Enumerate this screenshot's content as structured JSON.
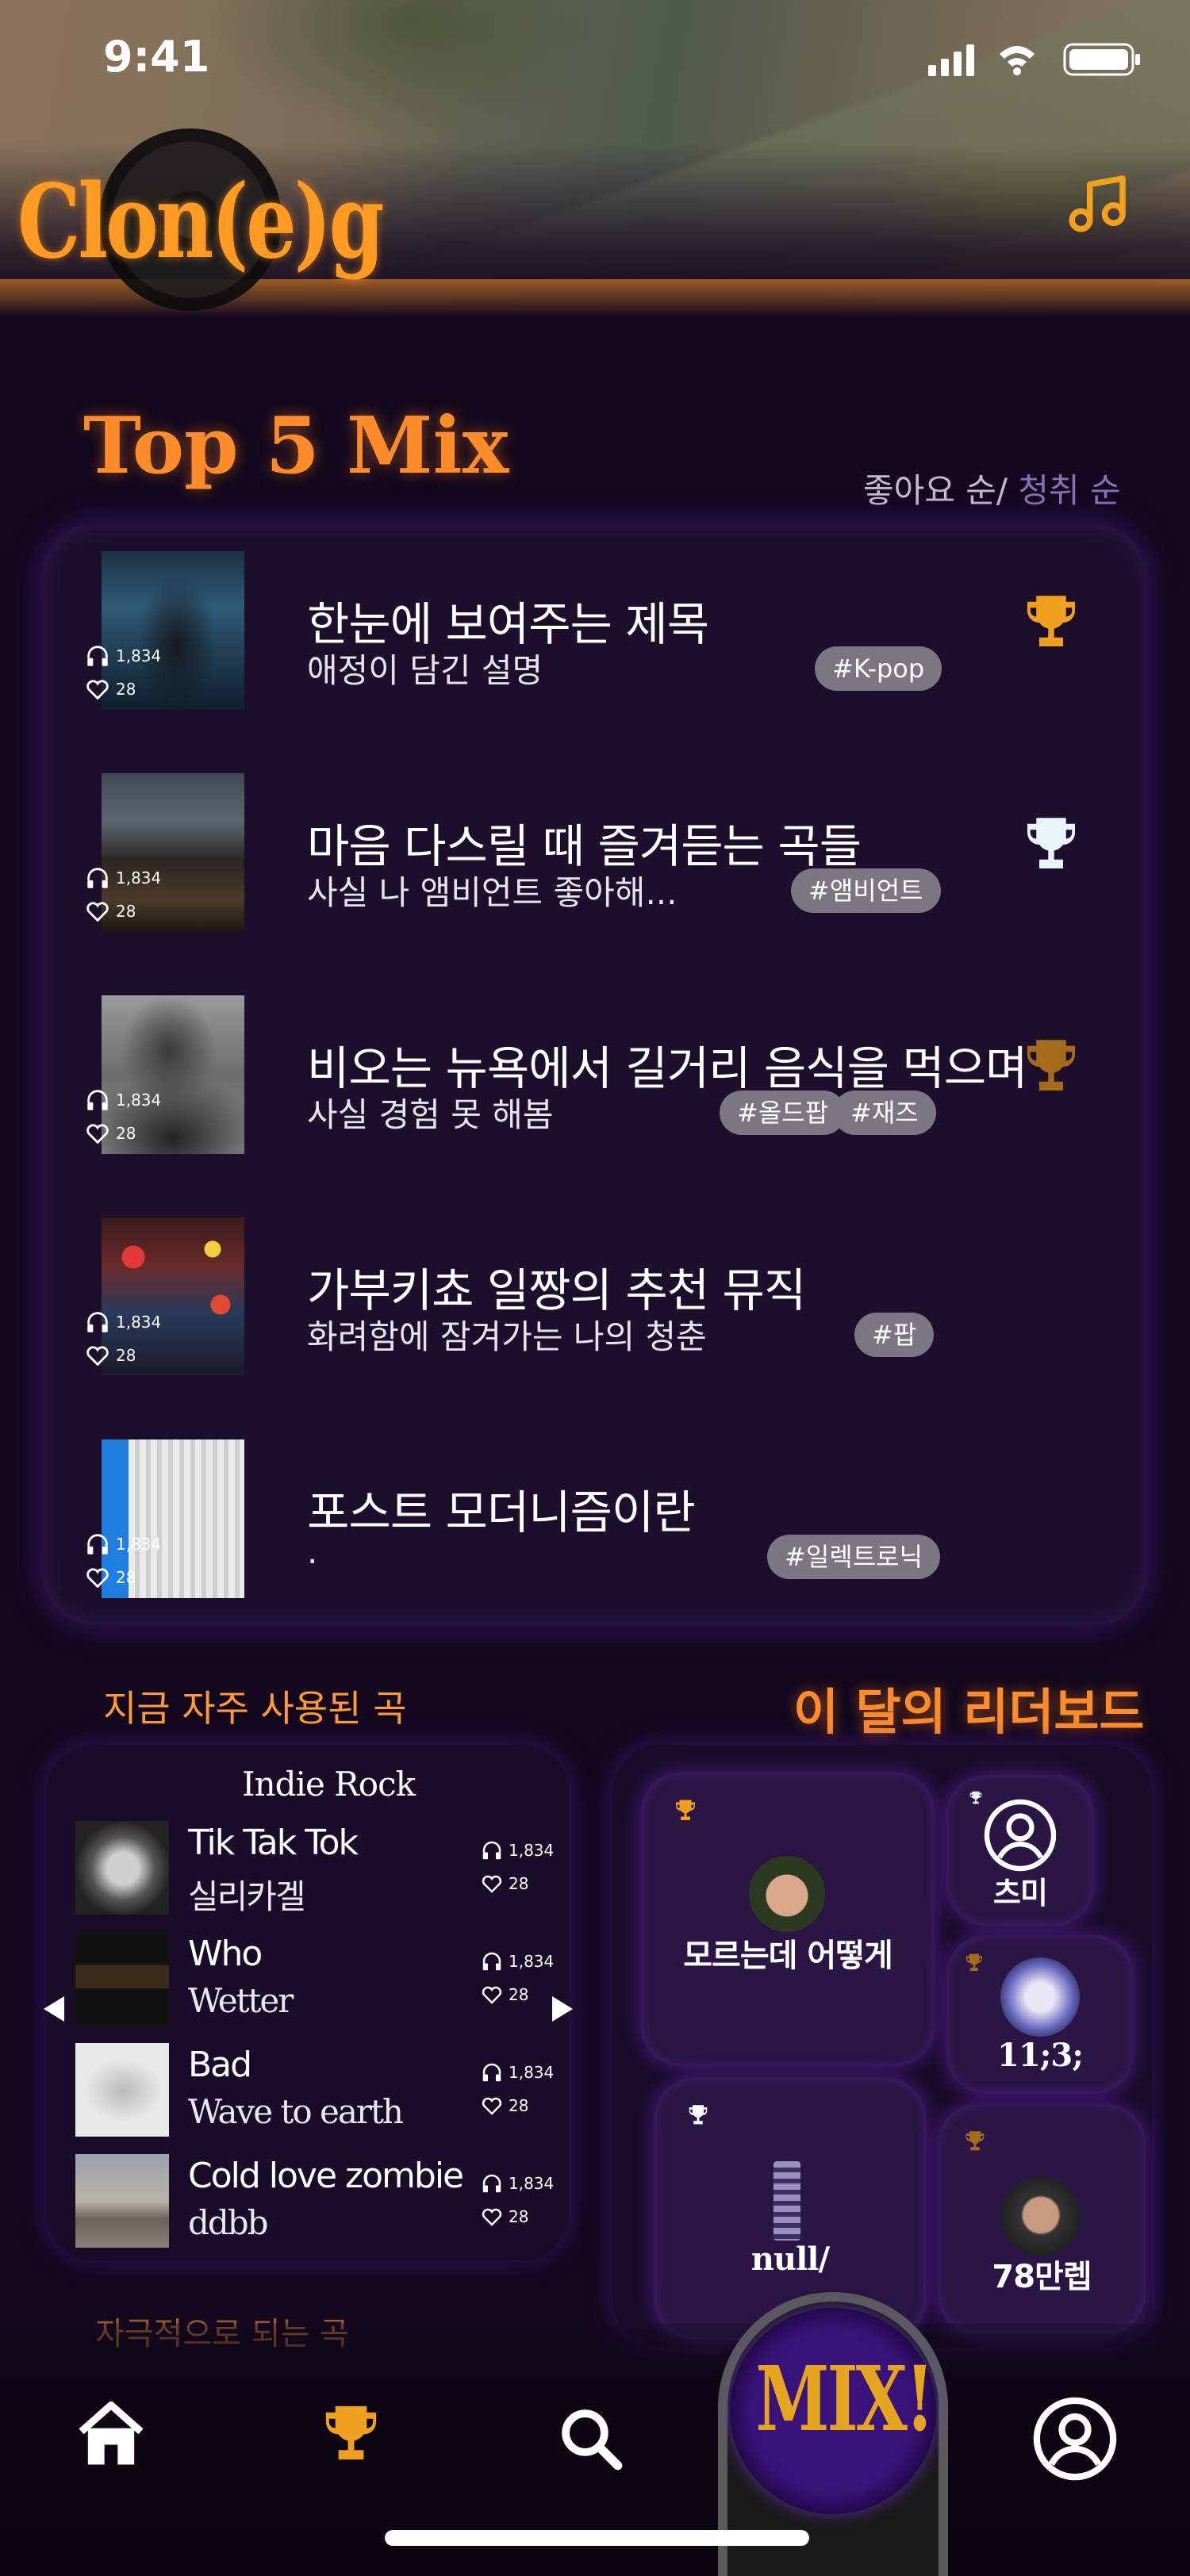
{
  "status_bar": {
    "time": "9:41"
  },
  "header": {
    "logo_text": "Clon(e)g"
  },
  "top5": {
    "title": "Top 5 Mix",
    "sort_primary": "좋아요 순/",
    "sort_secondary": " 청취 순",
    "rows": [
      {
        "title": "한눈에 보여주는 제목",
        "desc": "애정이 담긴 설명",
        "tags": [
          "#K-pop"
        ],
        "plays": "1,834",
        "likes": "28",
        "trophy_color": "#f0a01e"
      },
      {
        "title": "마음 다스릴 때 즐겨듣는 곡들",
        "desc": "사실 나 앰비언트 좋아해...",
        "tags": [
          "#앰비언트"
        ],
        "plays": "1,834",
        "likes": "28",
        "trophy_color": "#e8f4f8"
      },
      {
        "title": "비오는 뉴욕에서 길거리 음식을 먹으며",
        "desc": "사실 경험 못 해봄",
        "tags": [
          "#올드팝",
          "#재즈"
        ],
        "plays": "1,834",
        "likes": "28",
        "trophy_color": "#a66a1c"
      },
      {
        "title": "가부키쵸 일짱의 추천 뮤직",
        "desc": "화려함에 잠겨가는 나의 청춘",
        "tags": [
          "#팝"
        ],
        "plays": "1,834",
        "likes": "28",
        "trophy_color": ""
      },
      {
        "title": "포스트 모더니즘이란",
        "desc": ".",
        "tags": [
          "#일렉트로닉"
        ],
        "plays": "1,834",
        "likes": "28",
        "trophy_color": ""
      }
    ]
  },
  "frequent": {
    "title": "지금 자주 사용된 곡",
    "genre": "Indie Rock",
    "songs": [
      {
        "name": "Tik Tak Tok",
        "artist": "실리카겔",
        "plays": "1,834",
        "likes": "28"
      },
      {
        "name": "Who",
        "artist": "Wetter",
        "plays": "1,834",
        "likes": "28"
      },
      {
        "name": "Bad",
        "artist": "Wave to earth",
        "plays": "1,834",
        "likes": "28"
      },
      {
        "name": "Cold love zombie",
        "artist": "ddbb",
        "plays": "1,834",
        "likes": "28"
      }
    ]
  },
  "leaderboard": {
    "title": "이 달의 리더보드",
    "users": [
      {
        "name": "모르는데 어떻게"
      },
      {
        "name": "츠미"
      },
      {
        "name": "11;3;"
      },
      {
        "name": "null/"
      },
      {
        "name": "78만렙"
      }
    ]
  },
  "hidden_section_title": "자극적으로 되는 곡",
  "bottom_nav": {
    "mix_label": "MIX!"
  }
}
